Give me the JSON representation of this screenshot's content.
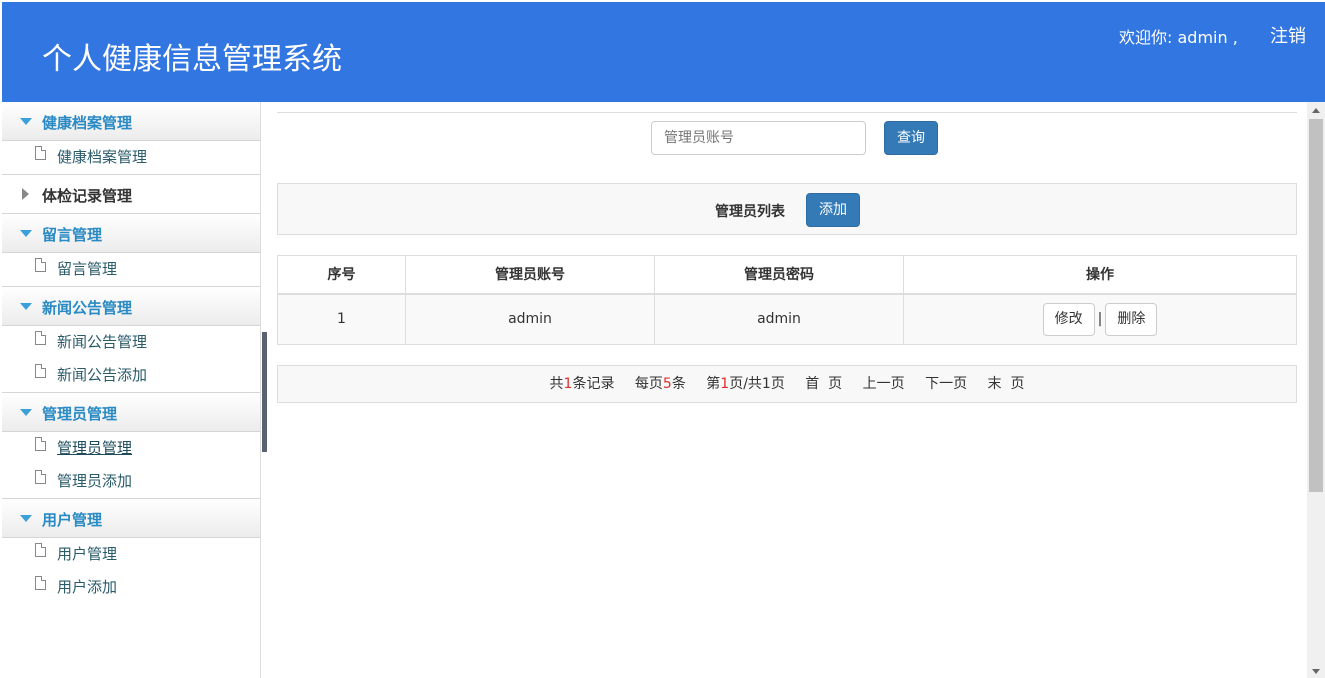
{
  "header": {
    "title": "个人健康信息管理系统",
    "welcome": "欢迎你: admin ,",
    "logout": "注销"
  },
  "sidebar": {
    "groups": [
      {
        "label": "健康档案管理",
        "expanded": true,
        "items": [
          {
            "label": "健康档案管理"
          }
        ]
      },
      {
        "label": "体检记录管理",
        "expanded": false,
        "items": []
      },
      {
        "label": "留言管理",
        "expanded": true,
        "items": [
          {
            "label": "留言管理"
          }
        ]
      },
      {
        "label": "新闻公告管理",
        "expanded": true,
        "items": [
          {
            "label": "新闻公告管理"
          },
          {
            "label": "新闻公告添加"
          }
        ]
      },
      {
        "label": "管理员管理",
        "expanded": true,
        "items": [
          {
            "label": "管理员管理",
            "active": true
          },
          {
            "label": "管理员添加"
          }
        ]
      },
      {
        "label": "用户管理",
        "expanded": true,
        "items": [
          {
            "label": "用户管理"
          },
          {
            "label": "用户添加"
          }
        ]
      }
    ]
  },
  "search": {
    "placeholder": "管理员账号",
    "value": "",
    "button": "查询"
  },
  "list": {
    "title": "管理员列表",
    "add_button": "添加"
  },
  "table": {
    "headers": [
      "序号",
      "管理员账号",
      "管理员密码",
      "操作"
    ],
    "rows": [
      {
        "index": "1",
        "account": "admin",
        "password": "admin"
      }
    ],
    "edit_label": "修改",
    "delete_label": "删除",
    "separator": "|"
  },
  "pager": {
    "total_prefix": "共",
    "total": "1",
    "total_suffix": "条记录",
    "per_page_prefix": "每页",
    "per_page": "5",
    "per_page_suffix": "条",
    "page_prefix": "第",
    "page": "1",
    "page_suffix": "页/共1页",
    "first": "首  页",
    "prev": "上一页",
    "next": "下一页",
    "last": "末  页"
  },
  "colors": {
    "header_bg": "#3276e2",
    "primary_button": "#337ab7",
    "sidebar_group_text": "#2a8ac4",
    "pager_highlight": "#e0302e"
  }
}
